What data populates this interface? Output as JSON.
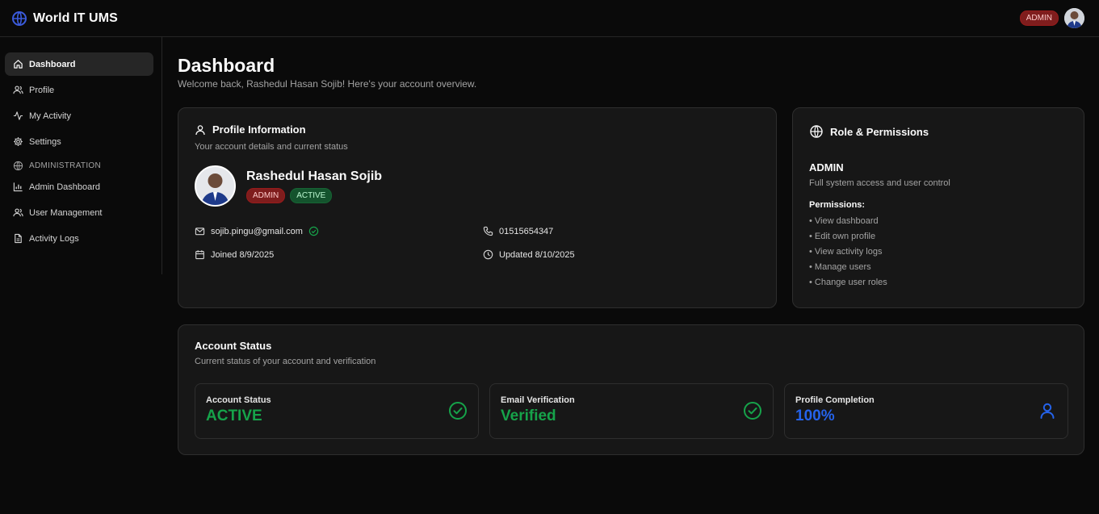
{
  "app": {
    "name": "World IT UMS"
  },
  "topbar": {
    "role_badge": "ADMIN"
  },
  "sidebar": {
    "items": [
      {
        "label": "Dashboard",
        "icon": "home-icon"
      },
      {
        "label": "Profile",
        "icon": "users-icon"
      },
      {
        "label": "My Activity",
        "icon": "activity-icon"
      },
      {
        "label": "Settings",
        "icon": "gear-icon"
      }
    ],
    "section_label": "ADMINISTRATION",
    "admin_items": [
      {
        "label": "Admin Dashboard",
        "icon": "bar-chart-icon"
      },
      {
        "label": "User Management",
        "icon": "users-icon"
      },
      {
        "label": "Activity Logs",
        "icon": "file-text-icon"
      }
    ]
  },
  "page": {
    "title": "Dashboard",
    "subtitle": "Welcome back, Rashedul Hasan Sojib! Here's your account overview."
  },
  "profile_card": {
    "title": "Profile Information",
    "description": "Your account details and current status",
    "name": "Rashedul Hasan Sojib",
    "role_badge": "ADMIN",
    "status_badge": "ACTIVE",
    "email": "sojib.pingu@gmail.com",
    "phone": "01515654347",
    "joined": "Joined 8/9/2025",
    "updated": "Updated 8/10/2025"
  },
  "role_card": {
    "title": "Role & Permissions",
    "role": "ADMIN",
    "role_description": "Full system access and user control",
    "permissions_heading": "Permissions:",
    "permissions": [
      "• View dashboard",
      "• Edit own profile",
      "• View activity logs",
      "• Manage users",
      "• Change user roles"
    ]
  },
  "status_card": {
    "title": "Account Status",
    "description": "Current status of your account and verification",
    "stats": [
      {
        "label": "Account Status",
        "value": "ACTIVE",
        "color": "#16a34a",
        "icon": "check-circle-icon"
      },
      {
        "label": "Email Verification",
        "value": "Verified",
        "color": "#16a34a",
        "icon": "check-circle-icon"
      },
      {
        "label": "Profile Completion",
        "value": "100%",
        "color": "#2563eb",
        "icon": "user-icon"
      }
    ]
  },
  "colors": {
    "background": "#0a0a0a",
    "card": "#171717",
    "success": "#16a34a",
    "accent_blue": "#2563eb",
    "danger_badge": "#7f1d1d"
  }
}
